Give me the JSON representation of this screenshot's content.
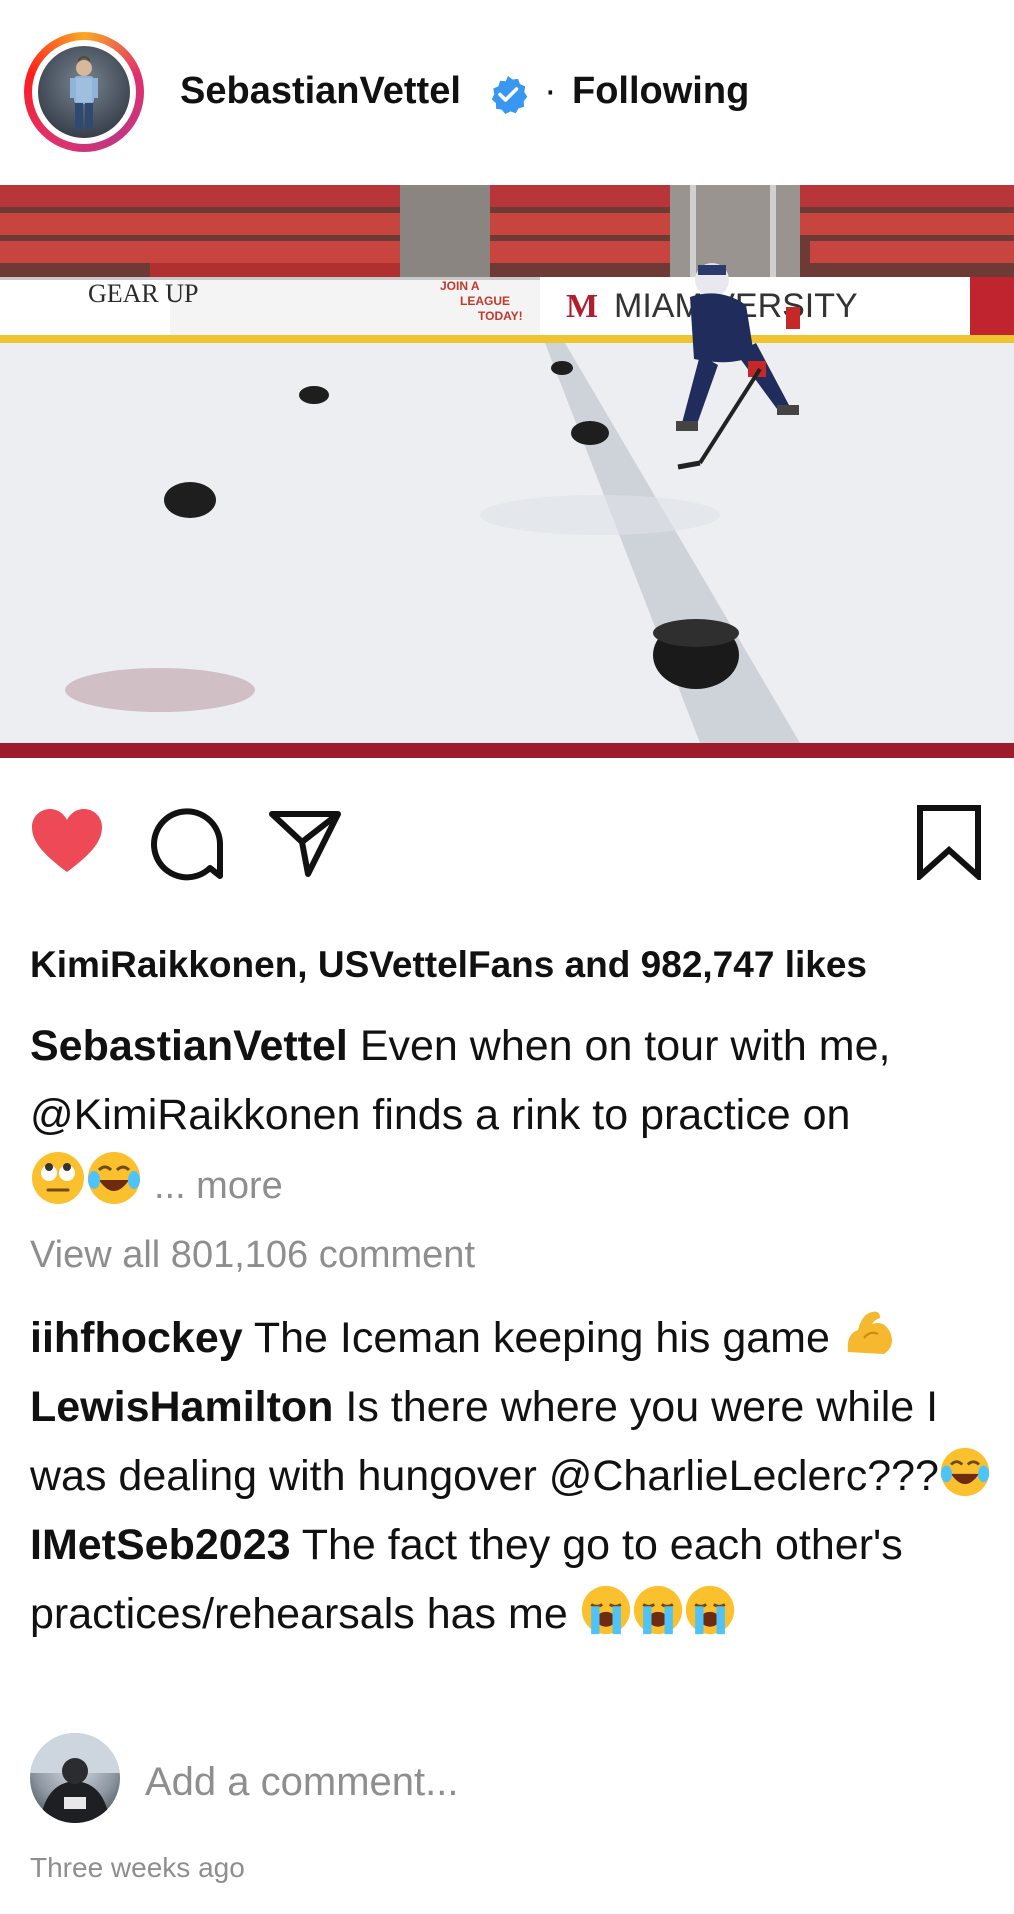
{
  "header": {
    "username": "SebastianVettel",
    "separator": "·",
    "follow_status": "Following",
    "verified_icon": "verified-badge-icon",
    "verified_color": "#3897f0"
  },
  "post": {
    "media_description_icon": "photo",
    "rink_banners": {
      "gear_up": "GEAR UP",
      "join": "JOIN A",
      "league": "LEAGUE",
      "today": "TODAY!",
      "miami_university": "MIAM    VERSITY"
    },
    "liked": true,
    "like_color": "#ed4956",
    "likes_text": "KimiRaikkonen, USVettelFans and 982,747 likes",
    "caption": {
      "author": "SebastianVettel",
      "text": "Even when on tour with me, @KimiRaikkonen finds a rink to practice on",
      "more": "... more"
    },
    "view_all": "View all 801,106 comment",
    "comments": [
      {
        "user": "iihfhockey",
        "text": "The Iceman keeping his game"
      },
      {
        "user": "LewisHamilton",
        "text": "Is there where you were while I was dealing with hungover @CharlieLeclerc???"
      },
      {
        "user": "IMetSeb2023",
        "text": "The fact they go to each other's practices/rehearsals has me"
      }
    ],
    "add_comment_placeholder": "Add a comment...",
    "timestamp": "Three weeks ago"
  }
}
